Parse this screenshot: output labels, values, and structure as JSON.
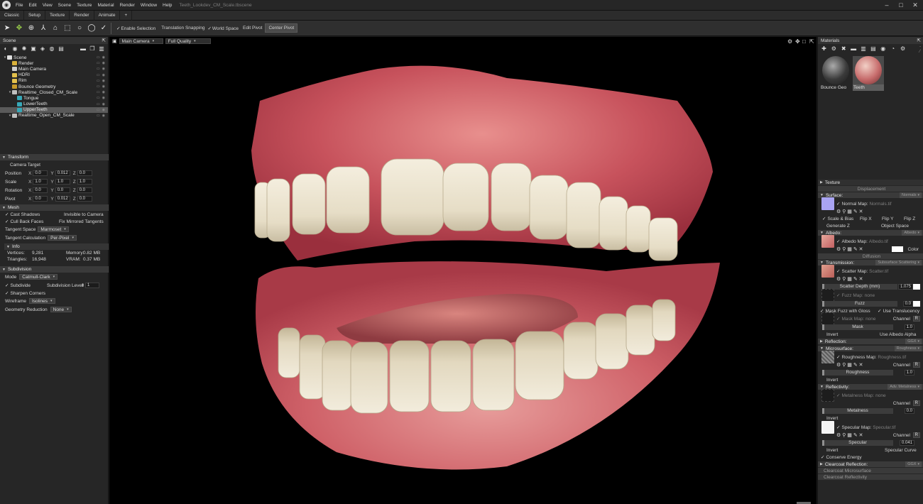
{
  "menubar": {
    "items": [
      "File",
      "Edit",
      "View",
      "Scene",
      "Texture",
      "Material",
      "Render",
      "Window",
      "Help"
    ],
    "title": "Teeth_Lookdev_CM_Scale.tbscene"
  },
  "tabs": [
    "Classic",
    "Setup",
    "Texture",
    "Render",
    "Animate",
    "+"
  ],
  "toolbar": {
    "enable_selection": "Enable Selection",
    "translation_snapping": "Translation Snapping",
    "world_space": "World Space",
    "edit_pivot": "Edit Pivot",
    "center_pivot": "Center Pivot"
  },
  "scene_panel": {
    "title": "Scene",
    "tree": [
      {
        "label": "Scene",
        "indent": 0,
        "icon": "#e0e0e0"
      },
      {
        "label": "Render",
        "indent": 1,
        "icon": "#d9b13b"
      },
      {
        "label": "Main Camera",
        "indent": 1,
        "icon": "#cfcfcf"
      },
      {
        "label": "HDRI",
        "indent": 1,
        "icon": "#e4c14c"
      },
      {
        "label": "Rim",
        "indent": 1,
        "icon": "#e4c14c"
      },
      {
        "label": "Bounce Geometry",
        "indent": 1,
        "icon": "#c79a2a"
      },
      {
        "label": "Realtime_Closed_CM_Scale",
        "indent": 1,
        "icon": "#bfbfbf"
      },
      {
        "label": "Tongue",
        "indent": 2,
        "icon": "#37a8b8"
      },
      {
        "label": "LowerTeeth",
        "indent": 2,
        "icon": "#37a8b8"
      },
      {
        "label": "UpperTeeth",
        "indent": 2,
        "icon": "#37a8b8",
        "selected": true
      },
      {
        "label": "Realtime_Open_CM_Scale",
        "indent": 1,
        "icon": "#bfbfbf"
      }
    ]
  },
  "transform": {
    "title": "Transform",
    "camera_target": "Camera Target",
    "rows": [
      {
        "label": "Position",
        "x": "0.0",
        "y": "0.012",
        "z": "0.0"
      },
      {
        "label": "Scale",
        "x": "1.0",
        "y": "1.0",
        "z": "1.0"
      },
      {
        "label": "Rotation",
        "x": "0.0",
        "y": "0.0",
        "z": "0.0"
      },
      {
        "label": "Pivot",
        "x": "0.0",
        "y": "0.012",
        "z": "0.0"
      }
    ]
  },
  "mesh": {
    "title": "Mesh",
    "cast_shadows": "Cast Shadows",
    "invisible_to_camera": "Invisible to Camera",
    "cull_back_faces": "Cull Back Faces",
    "fix_mirrored_tangents": "Fix Mirrored Tangents",
    "tangent_space_label": "Tangent Space",
    "tangent_space_value": "Marmoset",
    "tangent_calc_label": "Tangent Calculation",
    "tangent_calc_value": "Per-Pixel",
    "info_title": "Info",
    "vertices_label": "Vertices:",
    "vertices": "9,281",
    "memory_label": "Memory:",
    "memory": "0.82 MB",
    "triangles_label": "Triangles:",
    "triangles": "16,948",
    "vram_label": "VRAM:",
    "vram": "0.37 MB"
  },
  "subdivision": {
    "title": "Subdivision",
    "mode_label": "Mode",
    "mode_value": "Catmull-Clark",
    "subdivide": "Subdivide",
    "level_label": "Subdivision Level",
    "level_value": "1",
    "sharpen_corners": "Sharpen Corners",
    "wireframe_label": "Wireframe",
    "wireframe_value": "Isolines",
    "geo_reduction_label": "Geometry Reduction",
    "geo_reduction_value": "None"
  },
  "viewport": {
    "camera": "Main Camera",
    "quality": "Full Quality"
  },
  "materials": {
    "title": "Materials",
    "swatches": [
      "Bounce Geo",
      "Teeth"
    ],
    "texture_label": "Texture",
    "displacement": "Displacement",
    "surface": {
      "title": "Surface:",
      "mode": "Normals",
      "map_label": "Normal Map:",
      "map_file": "Normals.tif",
      "scale_bias": "Scale & Bias",
      "flip_x": "Flip X",
      "flip_y": "Flip Y",
      "flip_z": "Flip Z",
      "generate_z": "Generate Z",
      "object_space": "Object Space"
    },
    "albedo": {
      "title": "Albedo:",
      "mode": "Albedo",
      "map_label": "Albedo Map:",
      "map_file": "Albedo.tif",
      "color": "Color"
    },
    "diffusion": "Diffusion",
    "transmission": {
      "title": "Transmission:",
      "mode": "Subsurface Scattering",
      "map_label": "Scatter Map:",
      "map_file": "Scatter.tif",
      "depth_label": "Scatter Depth (mm)",
      "depth_value": "1.075",
      "fuzz_map_label": "Fuzz Map:",
      "fuzz_map_file": "none",
      "fuzz_label": "Fuzz",
      "fuzz_value": "0.0",
      "mask_fuzz": "Mask Fuzz with Gloss",
      "use_translucency": "Use Translucency",
      "mask_map_label": "Mask Map:",
      "mask_map_file": "none",
      "channel": "Channel",
      "channel_value": "R",
      "mask_label": "Mask",
      "mask_value": "1.0",
      "invert": "Invert",
      "use_albedo_alpha": "Use Albedo Alpha"
    },
    "reflection": {
      "title": "Reflection:",
      "mode": "GGX"
    },
    "microsurface": {
      "title": "Microsurface:",
      "mode": "Roughness",
      "map_label": "Roughness Map:",
      "map_file": "Roughness.tif",
      "channel": "Channel",
      "channel_value": "R",
      "roughness_label": "Roughness",
      "roughness_value": "1.0",
      "invert": "Invert"
    },
    "reflectivity": {
      "title": "Reflectivity:",
      "mode": "Adv. Metalness",
      "metal_map_label": "Metalness Map:",
      "metal_map_file": "none",
      "channel": "Channel",
      "channel_value": "R",
      "metalness_label": "Metalness",
      "metalness_value": "0.0",
      "invert": "Invert",
      "spec_map_label": "Specular Map:",
      "spec_map_file": "Specular.tif",
      "spec_channel_value": "R",
      "specular_label": "Specular",
      "specular_value": "0.041",
      "invert2": "Invert",
      "specular_curve": "Specular Curve",
      "conserve_energy": "Conserve Energy"
    },
    "clearcoat_reflection": {
      "title": "Clearcoat Reflection:",
      "mode": "GGX"
    },
    "clearcoat_microsurface": "Clearcoat Microsurface",
    "clearcoat_reflectivity": "Clearcoat Reflectivity"
  }
}
